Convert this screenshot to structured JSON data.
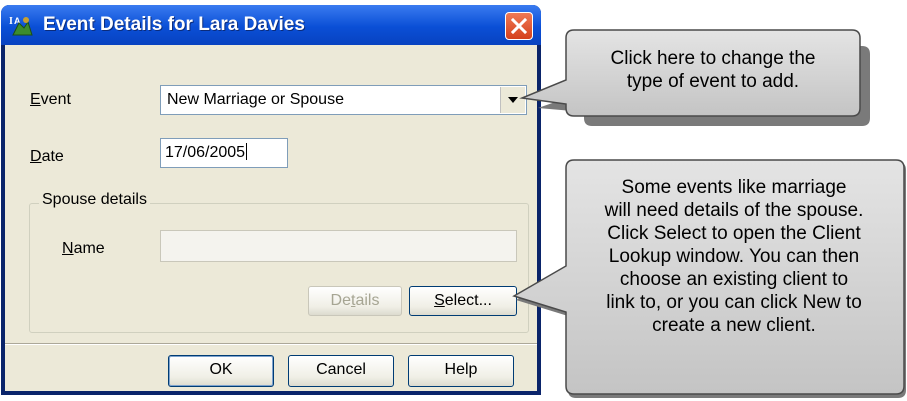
{
  "dialog": {
    "title": "Event Details for Lara Davies"
  },
  "form": {
    "event": {
      "label_u": "E",
      "label_rest": "vent",
      "value": "New Marriage or Spouse"
    },
    "date": {
      "label_u": "D",
      "label_rest": "ate",
      "value": "17/06/2005"
    },
    "spouse_group": {
      "title": "Spouse details",
      "name_label_u": "N",
      "name_label_rest": "ame",
      "name_value": ""
    },
    "details_button": {
      "pre": "De",
      "u": "t",
      "post": "ails"
    },
    "select_button": {
      "u": "S",
      "post": "elect..."
    }
  },
  "footer_buttons": {
    "ok": "OK",
    "cancel": "Cancel",
    "help": "Help"
  },
  "callouts": {
    "event_type": [
      "Click here to change the",
      "type of event to add."
    ],
    "spouse_select": [
      "Some events like marriage",
      "will need details of the spouse.",
      "Click Select to open the Client",
      "Lookup window. You can then",
      "choose an existing client to",
      "link to, or you can click New to",
      "create a new client."
    ]
  },
  "colors": {
    "titlebar": "#0a4fd6",
    "dialog_face": "#ece9d8",
    "callout_fill": "#cfcfcf"
  }
}
